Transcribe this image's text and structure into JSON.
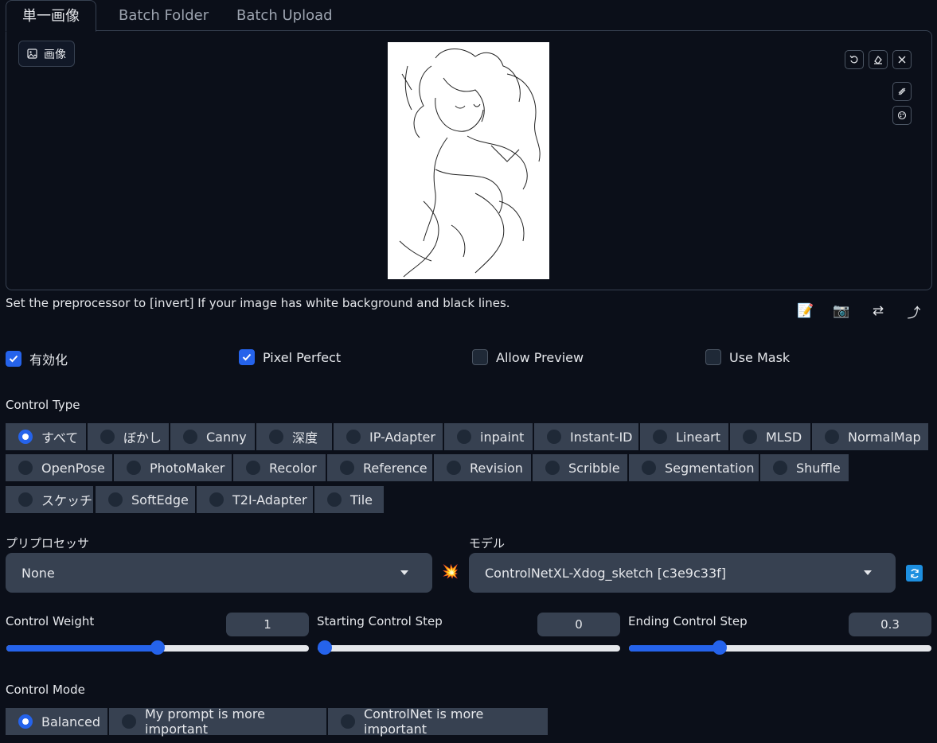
{
  "tabs": [
    "単一画像",
    "Batch Folder",
    "Batch Upload"
  ],
  "image_label": "画像",
  "note": "Set the preprocessor to [invert] If your image has white background and black lines.",
  "tools": [
    "📝",
    "📷",
    "⇄",
    "⤴"
  ],
  "checkboxes": [
    {
      "label": "有効化",
      "checked": true
    },
    {
      "label": "Pixel Perfect",
      "checked": true
    },
    {
      "label": "Allow Preview",
      "checked": false
    },
    {
      "label": "Use Mask",
      "checked": false
    }
  ],
  "control_type": {
    "label": "Control Type",
    "selected": "すべて",
    "options": [
      "すべて",
      "ぼかし",
      "Canny",
      "深度",
      "IP-Adapter",
      "inpaint",
      "Instant-ID",
      "Lineart",
      "MLSD",
      "NormalMap",
      "OpenPose",
      "PhotoMaker",
      "Recolor",
      "Reference",
      "Revision",
      "Scribble",
      "Segmentation",
      "Shuffle",
      "スケッチ",
      "SoftEdge",
      "T2I-Adapter",
      "Tile"
    ]
  },
  "preprocessor": {
    "label": "プリプロセッサ",
    "value": "None",
    "run_icon": "💥"
  },
  "model": {
    "label": "モデル",
    "value": "ControlNetXL-Xdog_sketch [c3e9c33f]"
  },
  "sliders": [
    {
      "label": "Control Weight",
      "value": "1",
      "fraction": 0.5
    },
    {
      "label": "Starting Control Step",
      "value": "0",
      "fraction": 0.0
    },
    {
      "label": "Ending Control Step",
      "value": "0.3",
      "fraction": 0.3
    }
  ],
  "control_mode": {
    "label": "Control Mode",
    "selected": "Balanced",
    "options": [
      "Balanced",
      "My prompt is more important",
      "ControlNet is more important"
    ]
  },
  "colors": {
    "accent": "#2563eb",
    "background": "#0b0f19",
    "button": "#374151"
  }
}
